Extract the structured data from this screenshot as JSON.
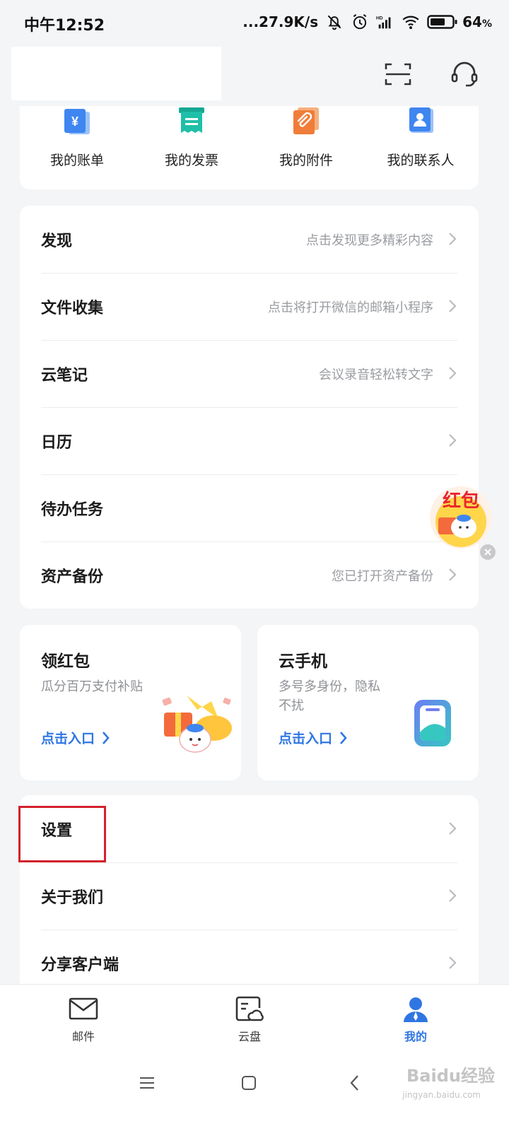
{
  "status_bar": {
    "time": "中午12:52",
    "net_speed": "...27.9K/s",
    "battery_pct": "64",
    "battery_unit": "%",
    "icons": [
      "bell-off-icon",
      "alarm-icon",
      "hd-signal-icon",
      "wifi-icon",
      "battery-icon"
    ]
  },
  "header": {
    "icons": [
      "scan-icon",
      "customer-service-icon"
    ]
  },
  "quick_actions": [
    {
      "label": "我的账单",
      "icon": "bill-icon",
      "color": "#3f86f0"
    },
    {
      "label": "我的发票",
      "icon": "invoice-icon",
      "color": "#1fbfa8"
    },
    {
      "label": "我的附件",
      "icon": "attachment-icon",
      "color": "#f07d3a"
    },
    {
      "label": "我的联系人",
      "icon": "contacts-icon",
      "color": "#3f86f0"
    }
  ],
  "menu_primary": [
    {
      "title": "发现",
      "subtitle": "点击发现更多精彩内容"
    },
    {
      "title": "文件收集",
      "subtitle": "点击将打开微信的邮箱小程序"
    },
    {
      "title": "云笔记",
      "subtitle": "会议录音轻松转文字"
    },
    {
      "title": "日历",
      "subtitle": ""
    },
    {
      "title": "待办任务",
      "subtitle": ""
    },
    {
      "title": "资产备份",
      "subtitle": "您已打开资产备份"
    }
  ],
  "promos": [
    {
      "title": "领红包",
      "desc": "瓜分百万支付补贴",
      "link": "点击入口"
    },
    {
      "title": "云手机",
      "desc": "多号多身份，隐私不扰",
      "link": "点击入口"
    }
  ],
  "floating_badge": {
    "label": "红包"
  },
  "menu_secondary": [
    {
      "title": "设置"
    },
    {
      "title": "关于我们"
    },
    {
      "title": "分享客户端"
    }
  ],
  "tabs": [
    {
      "label": "邮件",
      "icon": "mail-icon",
      "active": false
    },
    {
      "label": "云盘",
      "icon": "cloud-drive-icon",
      "active": false
    },
    {
      "label": "我的",
      "icon": "profile-icon",
      "active": true
    }
  ],
  "watermark": {
    "text": "Baidu经验",
    "sub": "jingyan.baidu.com"
  },
  "colors": {
    "accent": "#2f76e3",
    "highlight": "#d3212b",
    "background": "#f4f5f7"
  }
}
